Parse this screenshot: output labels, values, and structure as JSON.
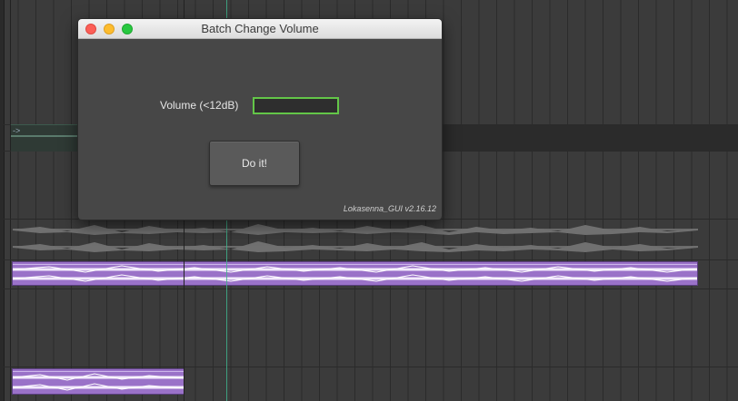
{
  "dialog": {
    "title": "Batch Change Volume",
    "volume_label": "Volume (<12dB)",
    "volume_value": "",
    "do_button_label": "Do it!",
    "version_text": "Lokasenna_GUI v2.16.12"
  },
  "arrange": {
    "teal_item_label": "->",
    "colors": {
      "item_purple": "#9a72c8",
      "edit_cursor": "#3fb38c",
      "input_focus": "#63c648"
    }
  }
}
